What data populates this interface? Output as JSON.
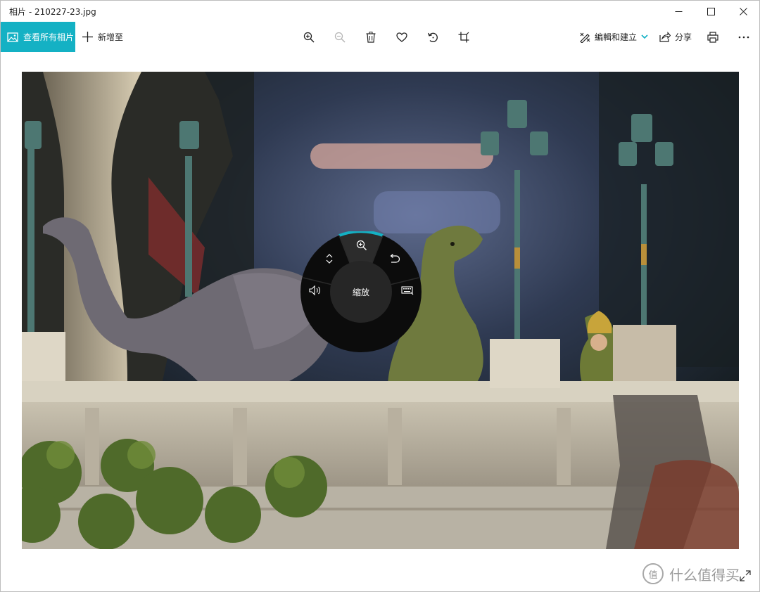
{
  "window": {
    "title": "相片 - 210227-23.jpg"
  },
  "toolbar": {
    "see_all_label": "查看所有相片",
    "add_to_label": "新增至",
    "edit_create_label": "編輯和建立",
    "share_label": "分享"
  },
  "dial": {
    "center_label": "縮放",
    "accent_color": "#14b1c4"
  },
  "watermark": {
    "badge": "值",
    "text": "什么值得买"
  },
  "colors": {
    "accent": "#14b1c4"
  }
}
